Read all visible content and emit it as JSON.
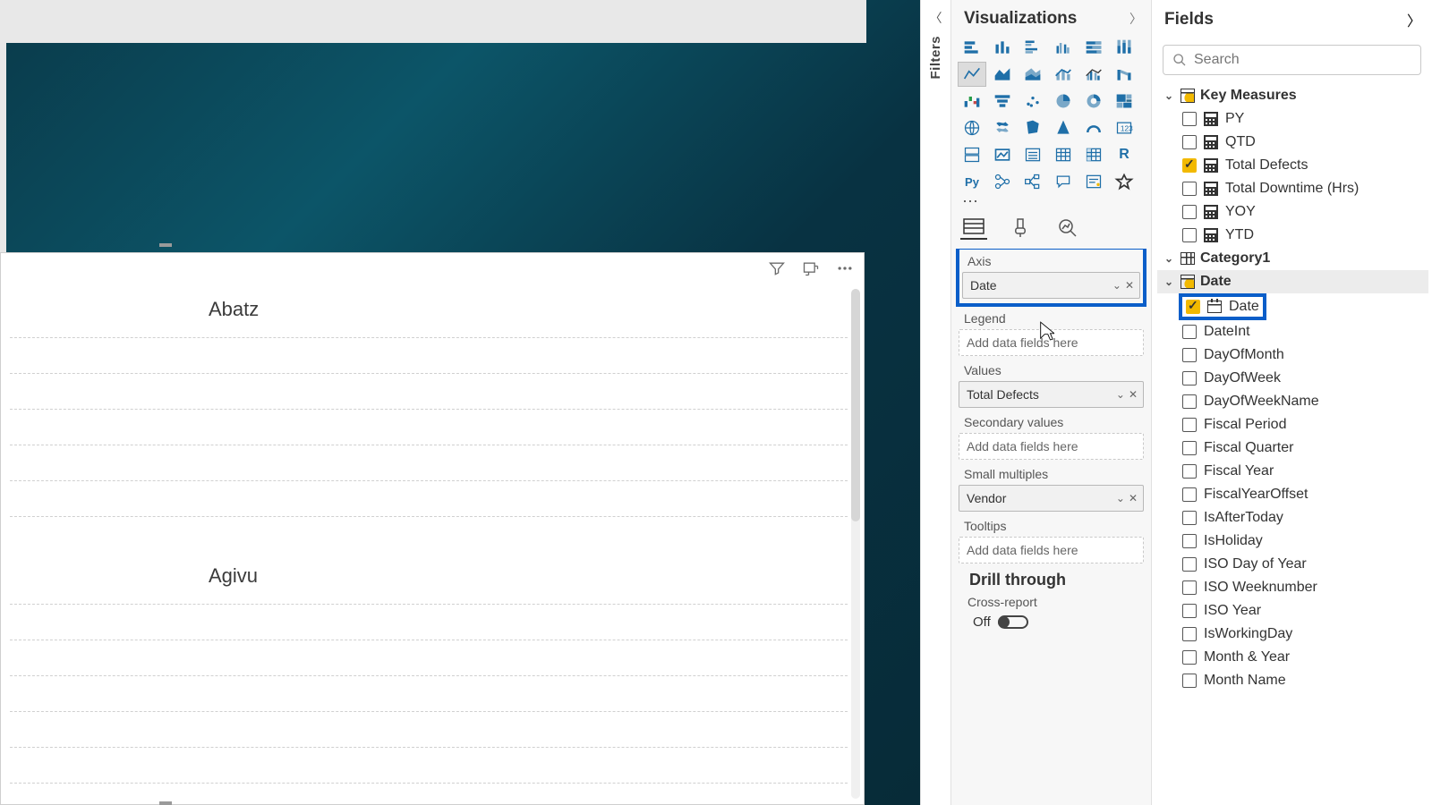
{
  "filters": {
    "label": "Filters"
  },
  "viz": {
    "title": "Visualizations",
    "wells": {
      "axis_label": "Axis",
      "axis_value": "Date",
      "legend_label": "Legend",
      "legend_placeholder": "Add data fields here",
      "values_label": "Values",
      "values_value": "Total Defects",
      "secondary_label": "Secondary values",
      "secondary_placeholder": "Add data fields here",
      "small_label": "Small multiples",
      "small_value": "Vendor",
      "tooltips_label": "Tooltips",
      "tooltips_placeholder": "Add data fields here"
    },
    "drill_title": "Drill through",
    "cross_label": "Cross-report",
    "toggle_off": "Off"
  },
  "fields": {
    "title": "Fields",
    "search_placeholder": "Search",
    "tables": {
      "key_measures": {
        "label": "Key Measures",
        "items": [
          {
            "name": "PY",
            "checked": false
          },
          {
            "name": "QTD",
            "checked": false
          },
          {
            "name": "Total Defects",
            "checked": true
          },
          {
            "name": "Total Downtime (Hrs)",
            "checked": false
          },
          {
            "name": "YOY",
            "checked": false
          },
          {
            "name": "YTD",
            "checked": false
          }
        ]
      },
      "category1": {
        "label": "Category1"
      },
      "date": {
        "label": "Date",
        "items": [
          {
            "name": "Date",
            "checked": true,
            "highlight": true,
            "icon": "date"
          },
          {
            "name": "DateInt",
            "checked": false
          },
          {
            "name": "DayOfMonth",
            "checked": false
          },
          {
            "name": "DayOfWeek",
            "checked": false
          },
          {
            "name": "DayOfWeekName",
            "checked": false
          },
          {
            "name": "Fiscal Period",
            "checked": false
          },
          {
            "name": "Fiscal Quarter",
            "checked": false
          },
          {
            "name": "Fiscal Year",
            "checked": false
          },
          {
            "name": "FiscalYearOffset",
            "checked": false
          },
          {
            "name": "IsAfterToday",
            "checked": false
          },
          {
            "name": "IsHoliday",
            "checked": false
          },
          {
            "name": "ISO Day of Year",
            "checked": false
          },
          {
            "name": "ISO Weeknumber",
            "checked": false
          },
          {
            "name": "ISO Year",
            "checked": false
          },
          {
            "name": "IsWorkingDay",
            "checked": false
          },
          {
            "name": "Month & Year",
            "checked": false
          },
          {
            "name": "Month Name",
            "checked": false
          }
        ]
      }
    }
  },
  "canvas": {
    "categories": [
      "Abatz",
      "Agivu"
    ]
  }
}
